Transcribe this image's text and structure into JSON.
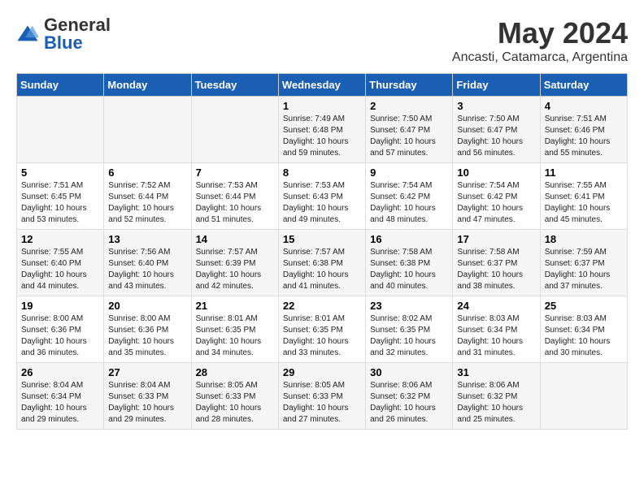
{
  "logo": {
    "general": "General",
    "blue": "Blue"
  },
  "title": "May 2024",
  "subtitle": "Ancasti, Catamarca, Argentina",
  "days_of_week": [
    "Sunday",
    "Monday",
    "Tuesday",
    "Wednesday",
    "Thursday",
    "Friday",
    "Saturday"
  ],
  "weeks": [
    [
      {
        "day": "",
        "info": ""
      },
      {
        "day": "",
        "info": ""
      },
      {
        "day": "",
        "info": ""
      },
      {
        "day": "1",
        "info": "Sunrise: 7:49 AM\nSunset: 6:48 PM\nDaylight: 10 hours and 59 minutes."
      },
      {
        "day": "2",
        "info": "Sunrise: 7:50 AM\nSunset: 6:47 PM\nDaylight: 10 hours and 57 minutes."
      },
      {
        "day": "3",
        "info": "Sunrise: 7:50 AM\nSunset: 6:47 PM\nDaylight: 10 hours and 56 minutes."
      },
      {
        "day": "4",
        "info": "Sunrise: 7:51 AM\nSunset: 6:46 PM\nDaylight: 10 hours and 55 minutes."
      }
    ],
    [
      {
        "day": "5",
        "info": "Sunrise: 7:51 AM\nSunset: 6:45 PM\nDaylight: 10 hours and 53 minutes."
      },
      {
        "day": "6",
        "info": "Sunrise: 7:52 AM\nSunset: 6:44 PM\nDaylight: 10 hours and 52 minutes."
      },
      {
        "day": "7",
        "info": "Sunrise: 7:53 AM\nSunset: 6:44 PM\nDaylight: 10 hours and 51 minutes."
      },
      {
        "day": "8",
        "info": "Sunrise: 7:53 AM\nSunset: 6:43 PM\nDaylight: 10 hours and 49 minutes."
      },
      {
        "day": "9",
        "info": "Sunrise: 7:54 AM\nSunset: 6:42 PM\nDaylight: 10 hours and 48 minutes."
      },
      {
        "day": "10",
        "info": "Sunrise: 7:54 AM\nSunset: 6:42 PM\nDaylight: 10 hours and 47 minutes."
      },
      {
        "day": "11",
        "info": "Sunrise: 7:55 AM\nSunset: 6:41 PM\nDaylight: 10 hours and 45 minutes."
      }
    ],
    [
      {
        "day": "12",
        "info": "Sunrise: 7:55 AM\nSunset: 6:40 PM\nDaylight: 10 hours and 44 minutes."
      },
      {
        "day": "13",
        "info": "Sunrise: 7:56 AM\nSunset: 6:40 PM\nDaylight: 10 hours and 43 minutes."
      },
      {
        "day": "14",
        "info": "Sunrise: 7:57 AM\nSunset: 6:39 PM\nDaylight: 10 hours and 42 minutes."
      },
      {
        "day": "15",
        "info": "Sunrise: 7:57 AM\nSunset: 6:38 PM\nDaylight: 10 hours and 41 minutes."
      },
      {
        "day": "16",
        "info": "Sunrise: 7:58 AM\nSunset: 6:38 PM\nDaylight: 10 hours and 40 minutes."
      },
      {
        "day": "17",
        "info": "Sunrise: 7:58 AM\nSunset: 6:37 PM\nDaylight: 10 hours and 38 minutes."
      },
      {
        "day": "18",
        "info": "Sunrise: 7:59 AM\nSunset: 6:37 PM\nDaylight: 10 hours and 37 minutes."
      }
    ],
    [
      {
        "day": "19",
        "info": "Sunrise: 8:00 AM\nSunset: 6:36 PM\nDaylight: 10 hours and 36 minutes."
      },
      {
        "day": "20",
        "info": "Sunrise: 8:00 AM\nSunset: 6:36 PM\nDaylight: 10 hours and 35 minutes."
      },
      {
        "day": "21",
        "info": "Sunrise: 8:01 AM\nSunset: 6:35 PM\nDaylight: 10 hours and 34 minutes."
      },
      {
        "day": "22",
        "info": "Sunrise: 8:01 AM\nSunset: 6:35 PM\nDaylight: 10 hours and 33 minutes."
      },
      {
        "day": "23",
        "info": "Sunrise: 8:02 AM\nSunset: 6:35 PM\nDaylight: 10 hours and 32 minutes."
      },
      {
        "day": "24",
        "info": "Sunrise: 8:03 AM\nSunset: 6:34 PM\nDaylight: 10 hours and 31 minutes."
      },
      {
        "day": "25",
        "info": "Sunrise: 8:03 AM\nSunset: 6:34 PM\nDaylight: 10 hours and 30 minutes."
      }
    ],
    [
      {
        "day": "26",
        "info": "Sunrise: 8:04 AM\nSunset: 6:34 PM\nDaylight: 10 hours and 29 minutes."
      },
      {
        "day": "27",
        "info": "Sunrise: 8:04 AM\nSunset: 6:33 PM\nDaylight: 10 hours and 29 minutes."
      },
      {
        "day": "28",
        "info": "Sunrise: 8:05 AM\nSunset: 6:33 PM\nDaylight: 10 hours and 28 minutes."
      },
      {
        "day": "29",
        "info": "Sunrise: 8:05 AM\nSunset: 6:33 PM\nDaylight: 10 hours and 27 minutes."
      },
      {
        "day": "30",
        "info": "Sunrise: 8:06 AM\nSunset: 6:32 PM\nDaylight: 10 hours and 26 minutes."
      },
      {
        "day": "31",
        "info": "Sunrise: 8:06 AM\nSunset: 6:32 PM\nDaylight: 10 hours and 25 minutes."
      },
      {
        "day": "",
        "info": ""
      }
    ]
  ]
}
